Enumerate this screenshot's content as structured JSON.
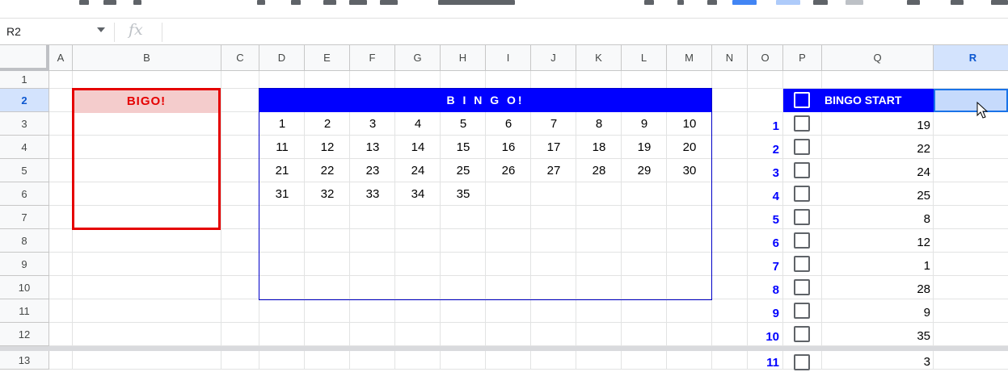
{
  "formula_bar": {
    "name_box": "R2",
    "fx_label": "fx",
    "formula": ""
  },
  "columns": [
    "A",
    "B",
    "C",
    "D",
    "E",
    "F",
    "G",
    "H",
    "I",
    "J",
    "K",
    "L",
    "M",
    "N",
    "O",
    "P",
    "Q",
    "R"
  ],
  "selected_column": "R",
  "rows": [
    "1",
    "2",
    "3",
    "4",
    "5",
    "6",
    "7",
    "8",
    "9",
    "10",
    "11",
    "12",
    "13"
  ],
  "selected_row": "2",
  "bigo_header": "BIGO!",
  "bingo_header": "B I N G O!",
  "bingo_start_label": "BINGO START",
  "bingo_numbers": [
    [
      "1",
      "2",
      "3",
      "4",
      "5",
      "6",
      "7",
      "8",
      "9",
      "10"
    ],
    [
      "11",
      "12",
      "13",
      "14",
      "15",
      "16",
      "17",
      "18",
      "19",
      "20"
    ],
    [
      "21",
      "22",
      "23",
      "24",
      "25",
      "26",
      "27",
      "28",
      "29",
      "30"
    ],
    [
      "31",
      "32",
      "33",
      "34",
      "35"
    ]
  ],
  "draw_list": [
    {
      "index": "1",
      "value": "19"
    },
    {
      "index": "2",
      "value": "22"
    },
    {
      "index": "3",
      "value": "24"
    },
    {
      "index": "4",
      "value": "25"
    },
    {
      "index": "5",
      "value": "8"
    },
    {
      "index": "6",
      "value": "12"
    },
    {
      "index": "7",
      "value": "1"
    },
    {
      "index": "8",
      "value": "28"
    },
    {
      "index": "9",
      "value": "9"
    },
    {
      "index": "10",
      "value": "35"
    },
    {
      "index": "11",
      "value": "3"
    }
  ],
  "colors": {
    "accent_blue": "#0000ff",
    "bigo_red": "#e50000",
    "bigo_fill": "#f4cccc",
    "selection": "#1a73e8"
  }
}
